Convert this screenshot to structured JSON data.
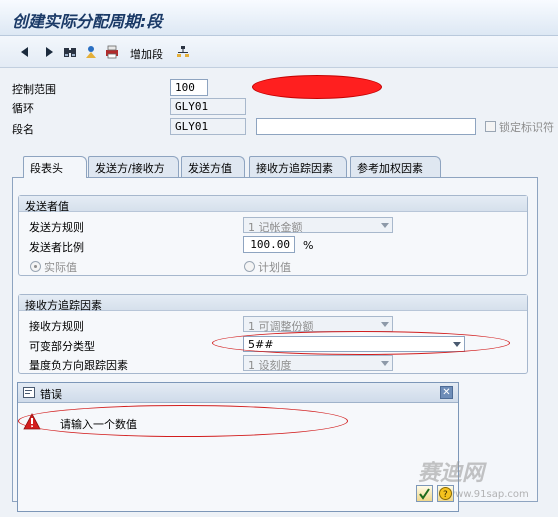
{
  "window": {
    "title": "创建实际分配周期:段"
  },
  "toolbar": {
    "add_segment_label": "增加段",
    "icons": [
      "back-icon",
      "forward-icon",
      "binoculars-icon",
      "person-icon",
      "printer-icon",
      "tree-icon"
    ]
  },
  "header": {
    "controlling_area_label": "控制范围",
    "controlling_area_value": "100",
    "cycle_label": "循环",
    "cycle_value": "GLY01",
    "segment_label": "段名",
    "segment_value": "GLY01",
    "segment_desc_value": "",
    "lock_indicator_label": "锁定标识符"
  },
  "tabs": [
    {
      "label": "段表头"
    },
    {
      "label": "发送方/接收方"
    },
    {
      "label": "发送方值"
    },
    {
      "label": "接收方追踪因素"
    },
    {
      "label": "参考加权因素"
    }
  ],
  "sender_values": {
    "group_title": "发送者值",
    "rule_label": "发送方规则",
    "rule_value": "1 记帐金额",
    "share_label": "发送者比例",
    "share_value": "100.00",
    "share_unit": "%",
    "actual_label": "实际值",
    "plan_label": "计划值"
  },
  "receiver_tracing": {
    "group_title": "接收方追踪因素",
    "rule_label": "接收方规则",
    "rule_value": "1 可调整份额",
    "var_portion_label": "可变部分类型",
    "var_portion_value": "5##",
    "neg_tracing_label": "量度负方向跟踪因素",
    "neg_tracing_value": "1 设刻度"
  },
  "error_dialog": {
    "title": "错误",
    "message": "请输入一个数值"
  },
  "watermark": {
    "text": "赛迪网",
    "url": "www.91sap.com"
  },
  "colors": {
    "redaction": "#ff1f1f",
    "annotation": "#d21e1e",
    "title": "#1b3a67"
  }
}
